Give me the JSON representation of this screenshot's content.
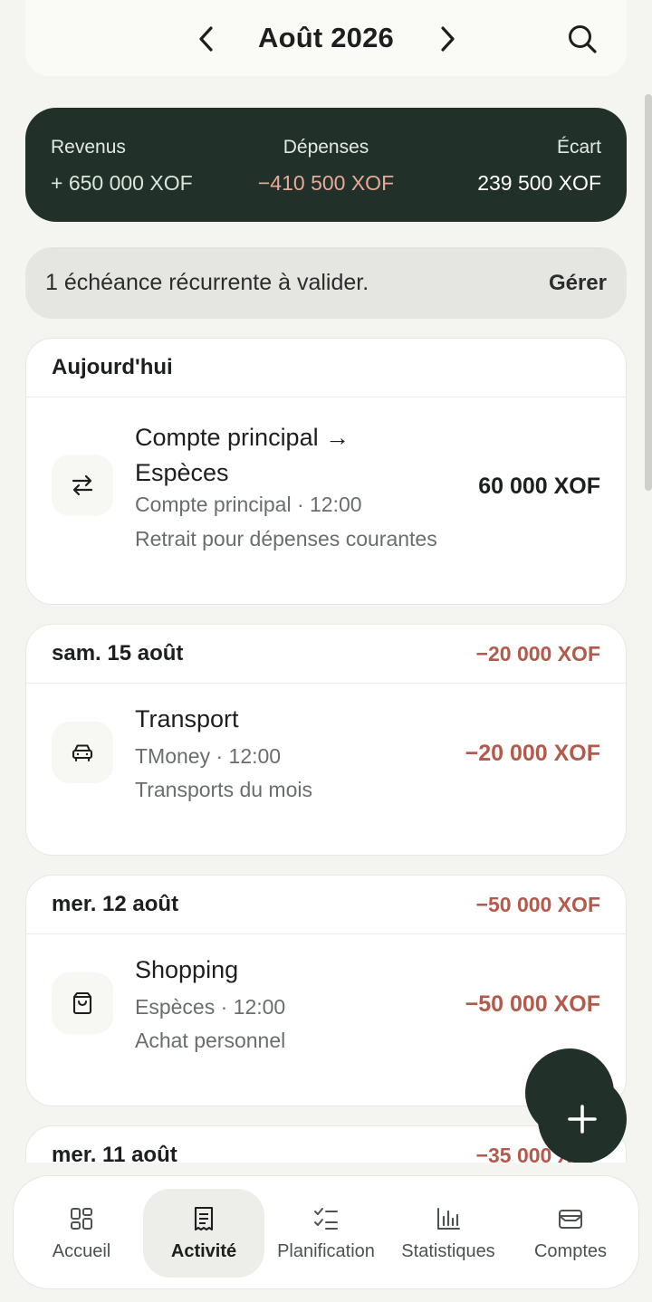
{
  "header": {
    "month_title": "Août 2026"
  },
  "summary": {
    "income_label": "Revenus",
    "income_value": "+ 650 000 XOF",
    "expense_label": "Dépenses",
    "expense_value": "−410 500 XOF",
    "gap_label": "Écart",
    "gap_value": "239 500 XOF"
  },
  "banner": {
    "text": "1 échéance récurrente à valider.",
    "action": "Gérer"
  },
  "days": [
    {
      "title": "Aujourd'hui",
      "total": "",
      "transactions": [
        {
          "icon": "transfer-icon",
          "title_line1": "Compte principal →",
          "title_line2": "Espèces",
          "meta": "Compte principal · 12:00",
          "note": "Retrait pour dépenses courantes",
          "amount": "60 000 XOF"
        }
      ]
    },
    {
      "title": "sam. 15 août",
      "total": "−20 000 XOF",
      "transactions": [
        {
          "icon": "car-icon",
          "title": "Transport",
          "meta": "TMoney · 12:00",
          "note": "Transports du mois",
          "amount": "−20 000 XOF"
        }
      ]
    },
    {
      "title": "mer. 12 août",
      "total": "−50 000 XOF",
      "transactions": [
        {
          "icon": "shopping-bag-icon",
          "title": "Shopping",
          "meta": "Espèces · 12:00",
          "note": "Achat personnel",
          "amount": "−50 000 XOF"
        }
      ]
    },
    {
      "title": "mer. 11 août",
      "total": "−35 000 XOF"
    }
  ],
  "bottom_nav": [
    {
      "label": "Accueil",
      "icon": "dashboard-icon",
      "active": false
    },
    {
      "label": "Activité",
      "icon": "receipt-icon",
      "active": true
    },
    {
      "label": "Planification",
      "icon": "checklist-icon",
      "active": false
    },
    {
      "label": "Statistiques",
      "icon": "bar-chart-icon",
      "active": false
    },
    {
      "label": "Comptes",
      "icon": "wallet-icon",
      "active": false
    }
  ],
  "colors": {
    "dark_green": "#213129",
    "negative": "#b35a4c",
    "background": "#f4f4f1"
  }
}
